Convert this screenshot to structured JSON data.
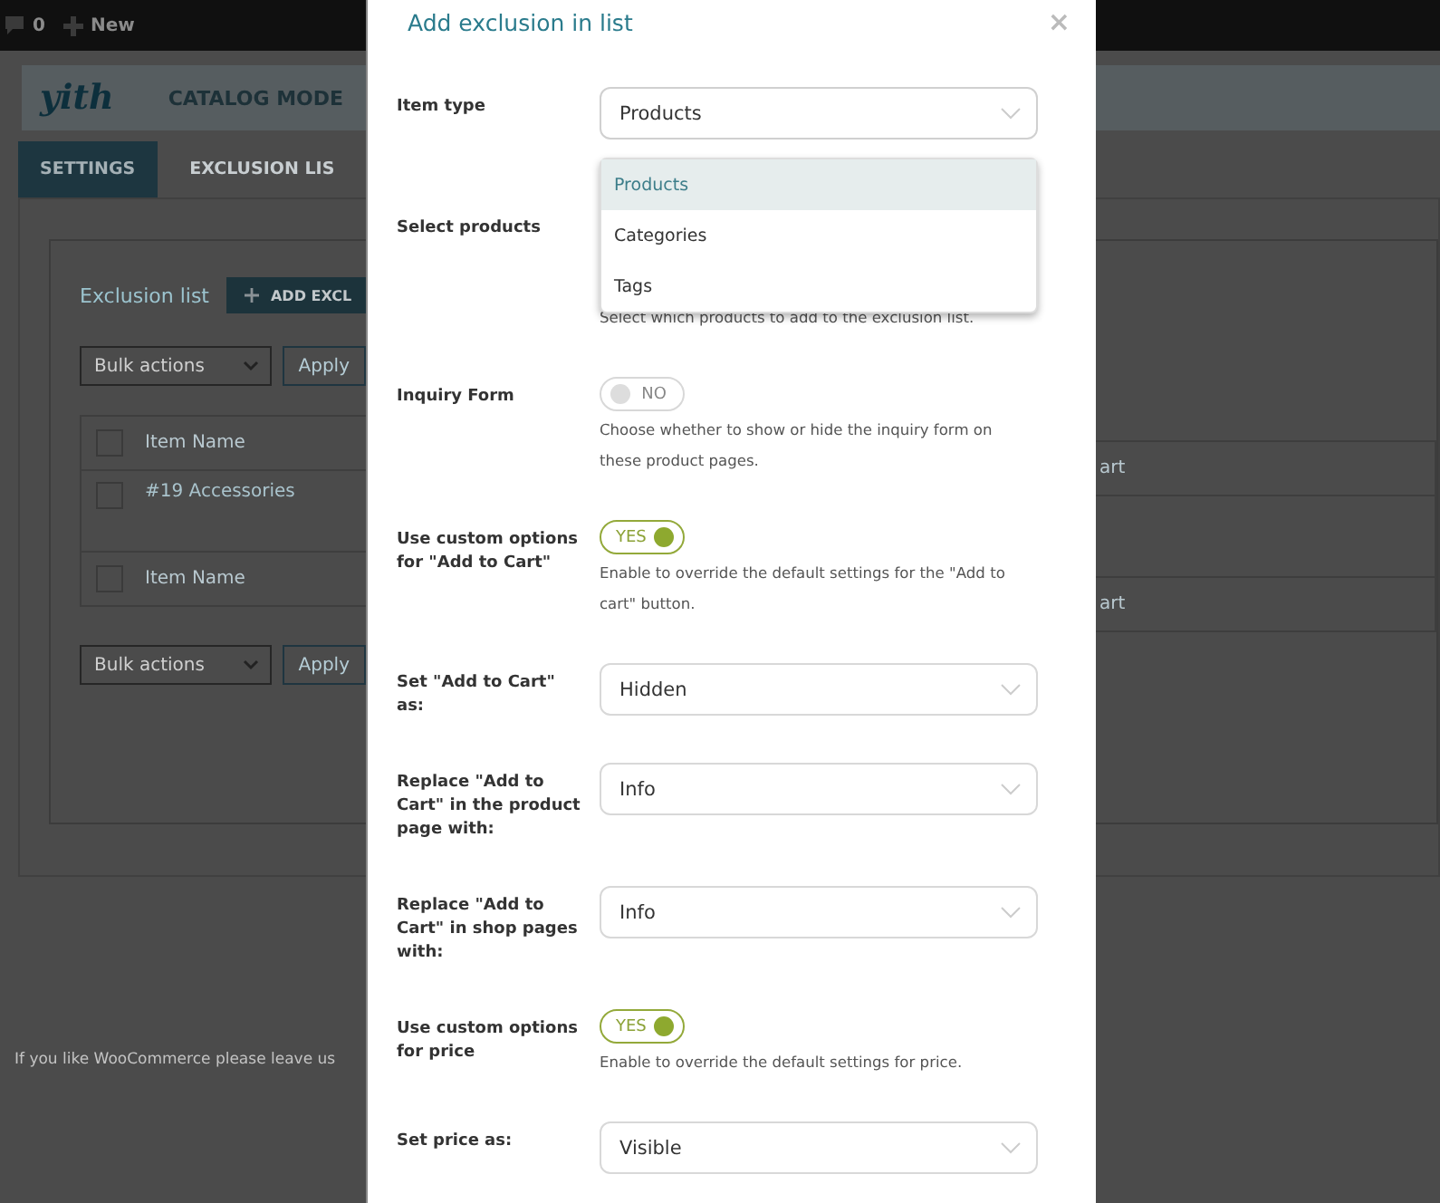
{
  "admin_bar": {
    "comments_count": "0",
    "new_label": "New"
  },
  "plugin_header": {
    "logo": "yith",
    "title": "CATALOG MODE"
  },
  "tabs": [
    {
      "label": "SETTINGS",
      "selected": true
    },
    {
      "label": "EXCLUSION LIS",
      "selected": false
    }
  ],
  "exclusion_list": {
    "title": "Exclusion list",
    "add_button": "ADD EXCL",
    "bulk_top": {
      "value": "Bulk actions",
      "apply": "Apply"
    },
    "table": {
      "header": {
        "checked": false,
        "column_1": "Item Name",
        "column_2": "art"
      },
      "rows": [
        {
          "checked": false,
          "column_1": "#19 Accessories"
        }
      ],
      "footer": {
        "checked": false,
        "column_1": "Item Name",
        "column_2": "art"
      }
    },
    "bulk_bottom": {
      "value": "Bulk actions",
      "apply": "Apply"
    }
  },
  "footer_text": "If you like WooCommerce please leave us",
  "modal": {
    "title": "Add exclusion in list",
    "close": "×",
    "fields": [
      {
        "kind": "select",
        "label": "Item type",
        "value": "Products",
        "dropdown": {
          "options": [
            {
              "label": "Products",
              "selected": true
            },
            {
              "label": "Categories",
              "selected": false
            },
            {
              "label": "Tags",
              "selected": false
            }
          ]
        }
      },
      {
        "kind": "products",
        "label": "Select products",
        "hint": "Select which products to add to the exclusion list."
      },
      {
        "kind": "toggle",
        "label": "Inquiry Form",
        "on": false,
        "state_label": "NO",
        "hint": "Choose whether to show or hide the inquiry form on these product pages."
      },
      {
        "kind": "toggle",
        "label": "Use custom options for \"Add to Cart\"",
        "on": true,
        "state_label": "YES",
        "hint": "Enable to override the default settings for the \"Add to cart\" button."
      },
      {
        "kind": "select",
        "label": "Set \"Add to Cart\" as:",
        "value": "Hidden"
      },
      {
        "kind": "select",
        "label": "Replace \"Add to Cart\" in the product page with:",
        "value": "Info"
      },
      {
        "kind": "select",
        "label": "Replace \"Add to Cart\" in shop pages with:",
        "value": "Info"
      },
      {
        "kind": "toggle",
        "label": "Use custom options for price",
        "on": true,
        "state_label": "YES",
        "hint": "Enable to override the default settings for price."
      },
      {
        "kind": "select",
        "label": "Set price as:",
        "value": "Visible"
      }
    ]
  }
}
